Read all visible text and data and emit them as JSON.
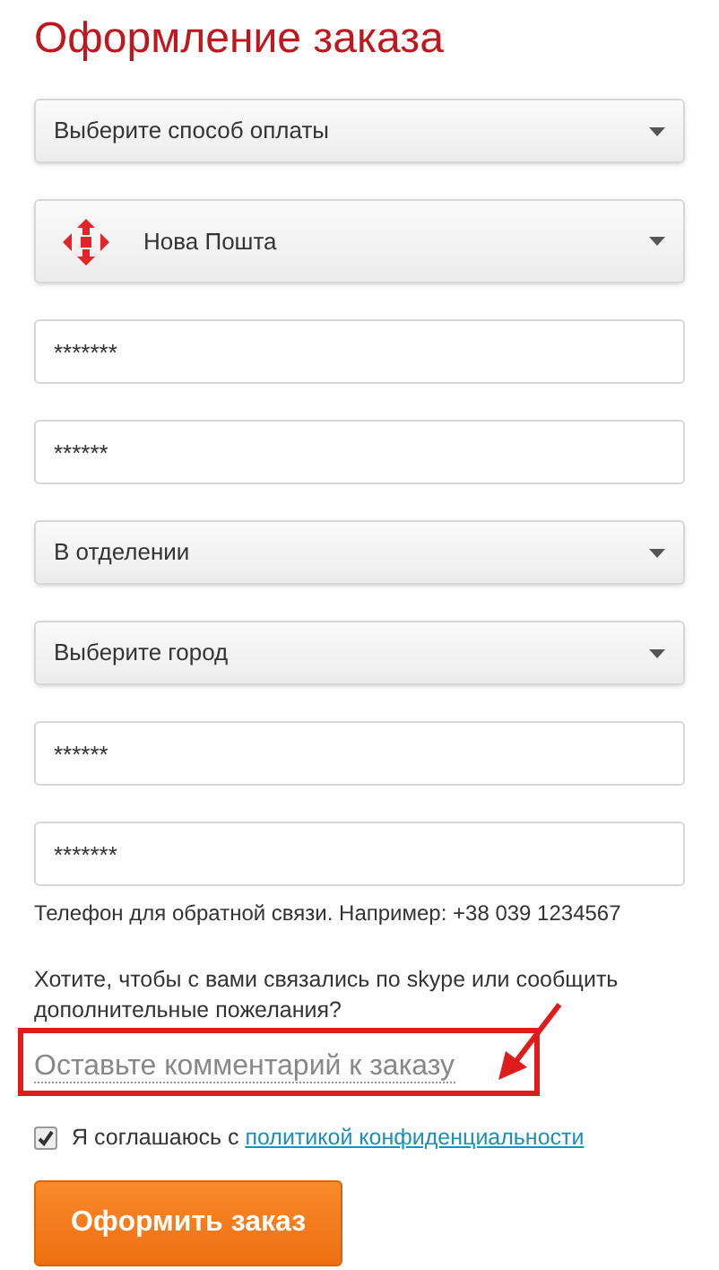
{
  "title": "Оформление заказа",
  "fields": [
    {
      "kind": "select",
      "value": "Выберите способ оплаты"
    },
    {
      "kind": "logo-select",
      "value": "Нова Пошта"
    },
    {
      "kind": "input",
      "value": "*******"
    },
    {
      "kind": "input",
      "value": "******"
    },
    {
      "kind": "select",
      "value": "В отделении"
    },
    {
      "kind": "select",
      "value": "Выберите город"
    },
    {
      "kind": "input",
      "value": "******"
    },
    {
      "kind": "input",
      "value": "*******"
    }
  ],
  "phone_hint": "Телефон для обратной связи. Например: +38 039 1234567",
  "comment_prompt": "Хотите, чтобы с вами связались по skype или сообщить дополнительные пожелания?",
  "comment_link": "Оставьте комментарий к заказу",
  "agree": {
    "checked": true,
    "text": "Я соглашаюсь с",
    "link": "политикой конфиденциальности"
  },
  "submit": "Оформить заказ"
}
